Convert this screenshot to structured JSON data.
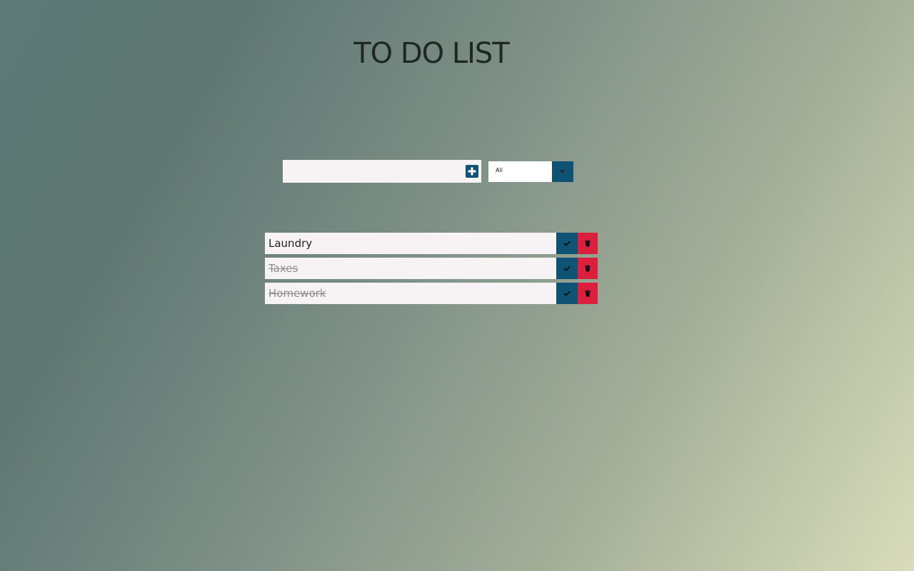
{
  "page": {
    "title": "TO DO LIST"
  },
  "add_form": {
    "input_value": "",
    "input_placeholder": "",
    "add_icon": "plus-square-icon"
  },
  "filter": {
    "selected": "All",
    "arrow_icon": "caret-down-icon"
  },
  "todos": [
    {
      "text": "Laundry",
      "completed": false
    },
    {
      "text": "Taxes",
      "completed": true
    },
    {
      "text": "Homework",
      "completed": true
    }
  ],
  "icons": {
    "complete": "check-icon",
    "delete": "trash-icon"
  },
  "colors": {
    "accent": "#0f5374",
    "danger": "#dc1f3c",
    "item_background": "#f7f3f4",
    "title_text": "#1f2723"
  }
}
